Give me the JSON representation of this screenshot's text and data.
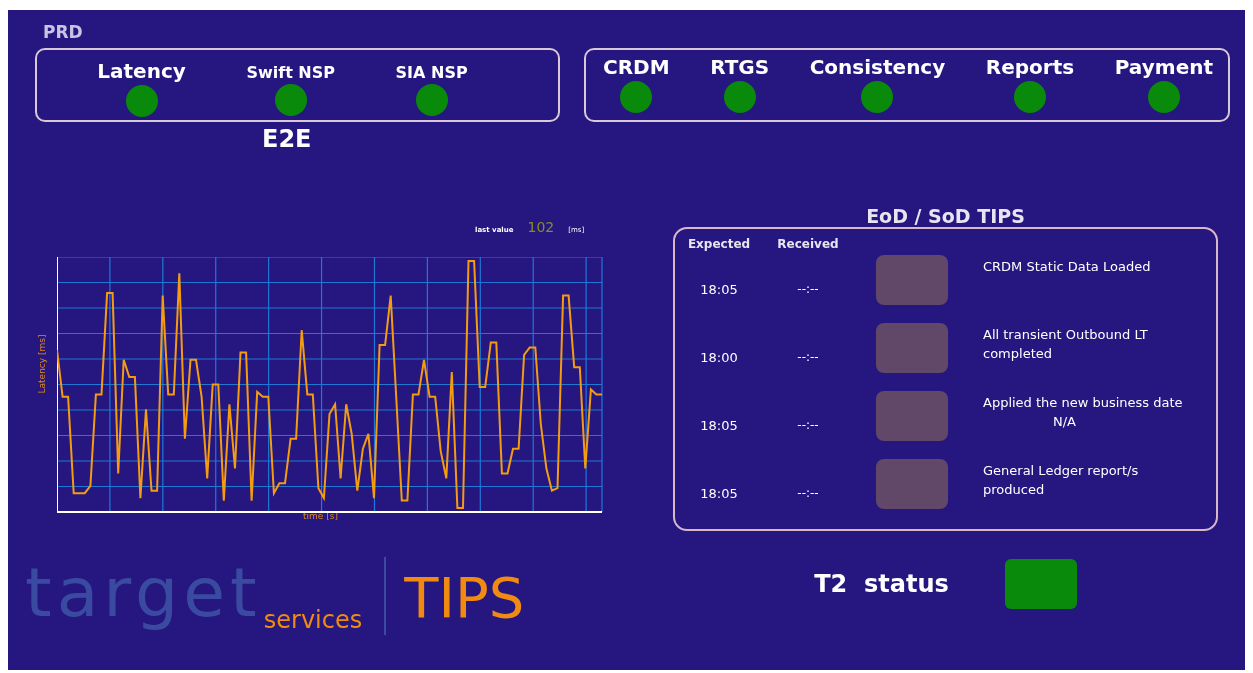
{
  "environment": "PRD",
  "e2e_panel": {
    "caption": "E2E",
    "lamps": [
      {
        "label": "Latency",
        "color": "#0a8a0a"
      },
      {
        "label": "Swift NSP",
        "color": "#0a8a0a"
      },
      {
        "label": "SIA NSP",
        "color": "#0a8a0a"
      }
    ]
  },
  "services_panel": {
    "lamps": [
      {
        "label": "CRDM",
        "color": "#0a8a0a"
      },
      {
        "label": "RTGS",
        "color": "#0a8a0a"
      },
      {
        "label": "Consistency",
        "color": "#0a8a0a"
      },
      {
        "label": "Reports",
        "color": "#0a8a0a"
      },
      {
        "label": "Payment",
        "color": "#0a8a0a"
      }
    ]
  },
  "latency_chart": {
    "last_value_label": "last value",
    "last_value": "102",
    "unit": "[ms]",
    "ylabel": "Latency [ms]",
    "xlabel": "time [s]"
  },
  "eod_sod": {
    "title": "EoD / SoD  TIPS",
    "columns": [
      "Expected",
      "Received"
    ],
    "rows": [
      {
        "expected": "18:05",
        "received": "--:--",
        "color": "#624868",
        "description": "CRDM Static Data Loaded"
      },
      {
        "expected": "18:00",
        "received": "--:--",
        "color": "#624868",
        "description": "All transient Outbound LT completed"
      },
      {
        "expected": "18:05",
        "received": "--:--",
        "color": "#624868",
        "description": "Applied the new business date",
        "note": "N/A"
      },
      {
        "expected": "18:05",
        "received": "--:--",
        "color": "#624868",
        "description": "General Ledger report/s produced"
      }
    ]
  },
  "t2_status": {
    "label": "T2  status",
    "color": "#0a8a0a"
  },
  "logo": {
    "brand": "target",
    "subbrand": "services",
    "product": "TIPS"
  }
}
